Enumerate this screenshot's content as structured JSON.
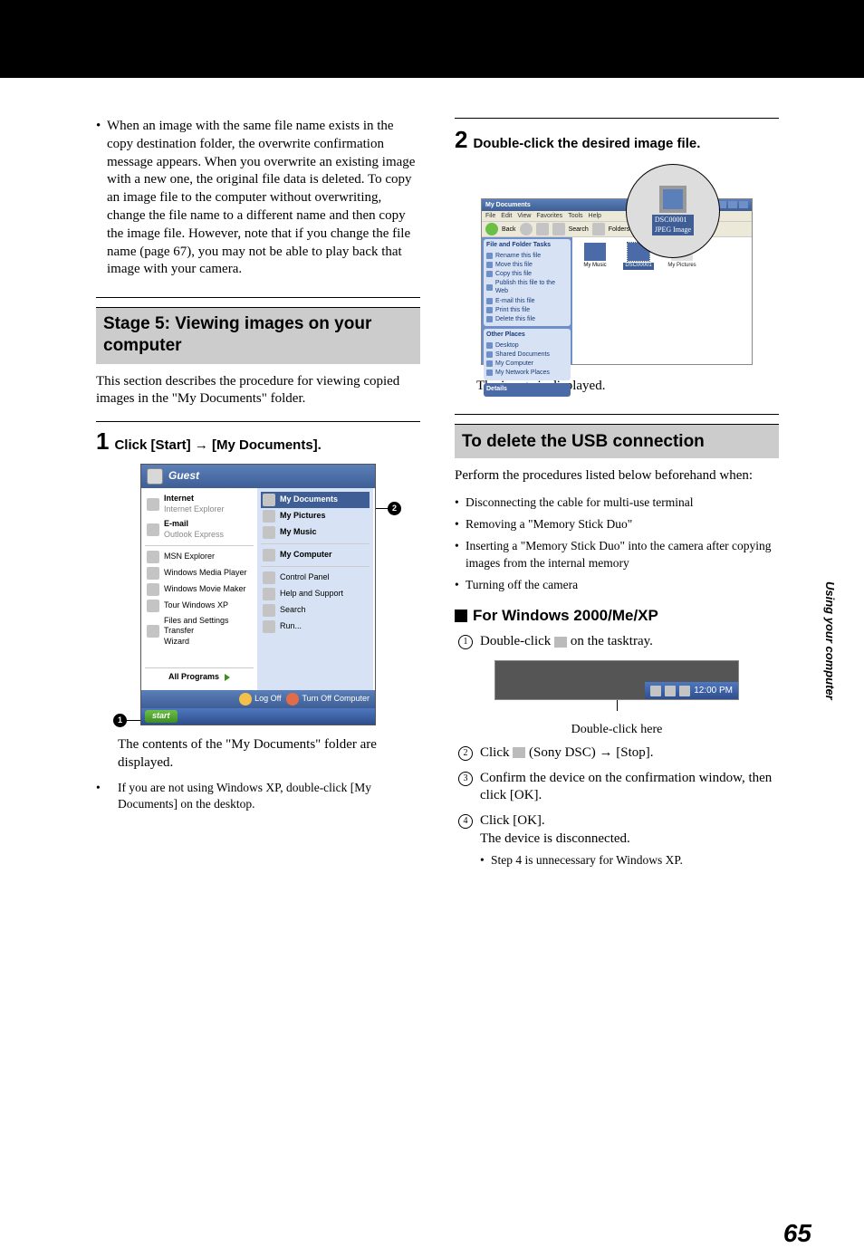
{
  "page_number": "65",
  "side_tab": "Using your computer",
  "left": {
    "note1": "When an image with the same file name exists in the copy destination folder, the overwrite confirmation message appears. When you overwrite an existing image with a new one, the original file data is deleted. To copy an image file to the computer without overwriting, change the file name to a different name and then copy the image file. However, note that if you change the file name (page 67), you may not be able to play back that image with your camera.",
    "stage_title": "Stage 5: Viewing images on your computer",
    "stage_body": "This section describes the procedure for viewing copied images in the \"My Documents\" folder.",
    "step1_num": "1",
    "step1_text": "Click [Start] → [My Documents].",
    "result1": "The contents of the \"My Documents\" folder are displayed.",
    "note2": "If you are not using Windows XP, double-click [My Documents] on the desktop.",
    "start_menu": {
      "user": "Guest",
      "left_items": [
        {
          "t1": "Internet",
          "t2": "Internet Explorer"
        },
        {
          "t1": "E-mail",
          "t2": "Outlook Express"
        },
        {
          "t1": "MSN Explorer"
        },
        {
          "t1": "Windows Media Player"
        },
        {
          "t1": "Windows Movie Maker"
        },
        {
          "t1": "Tour Windows XP"
        },
        {
          "t1": "Files and Settings Transfer",
          "t2": "Wizard"
        }
      ],
      "right_items": [
        "My Documents",
        "My Pictures",
        "My Music",
        "My Computer",
        "Control Panel",
        "Help and Support",
        "Search",
        "Run..."
      ],
      "all_programs": "All Programs",
      "logoff": "Log Off",
      "turnoff": "Turn Off Computer",
      "start": "start",
      "callout1": "1",
      "callout2": "2"
    }
  },
  "right": {
    "step2_num": "2",
    "step2_text": "Double-click the desired image file.",
    "result2": "The image is displayed.",
    "mydocs": {
      "mag_file": "DSC00001",
      "mag_type": "JPEG Image",
      "title": "My Documents",
      "menu": [
        "File",
        "Edit",
        "View",
        "Favorites",
        "Tools",
        "Help"
      ],
      "tool_back": "Back",
      "tool_search": "Search",
      "tool_folders": "Folders",
      "panel1_title": "File and Folder Tasks",
      "panel1_items": [
        "Rename this file",
        "Move this file",
        "Copy this file",
        "Publish this file to the Web",
        "E-mail this file",
        "Print this file",
        "Delete this file"
      ],
      "panel2_title": "Other Places",
      "panel2_items": [
        "Desktop",
        "Shared Documents",
        "My Computer",
        "My Network Places"
      ],
      "panel3_title": "Details",
      "folder1": "My Music",
      "folder2": "DSC00001",
      "folder3": "My Pictures"
    },
    "section_title": "To delete the USB connection",
    "section_body": "Perform the procedures listed below beforehand when:",
    "disc_bullets": [
      "Disconnecting the cable for multi-use terminal",
      "Removing a \"Memory Stick Duo\"",
      "Inserting a \"Memory Stick Duo\" into the camera after copying images from the internal memory",
      "Turning off the camera"
    ],
    "subhdr": "For Windows 2000/Me/XP",
    "num1_a": "Double-click",
    "num1_b": "on the tasktray.",
    "tray_time": "12:00 PM",
    "tray_label": "Double-click here",
    "num2_a": "Click",
    "num2_b": "(Sony DSC) → [Stop].",
    "num3": "Confirm the device on the confirmation window, then click [OK].",
    "num4": "Click [OK].",
    "num4_sub": "The device is disconnected.",
    "num4_bullet": "Step 4 is unnecessary for Windows XP."
  }
}
